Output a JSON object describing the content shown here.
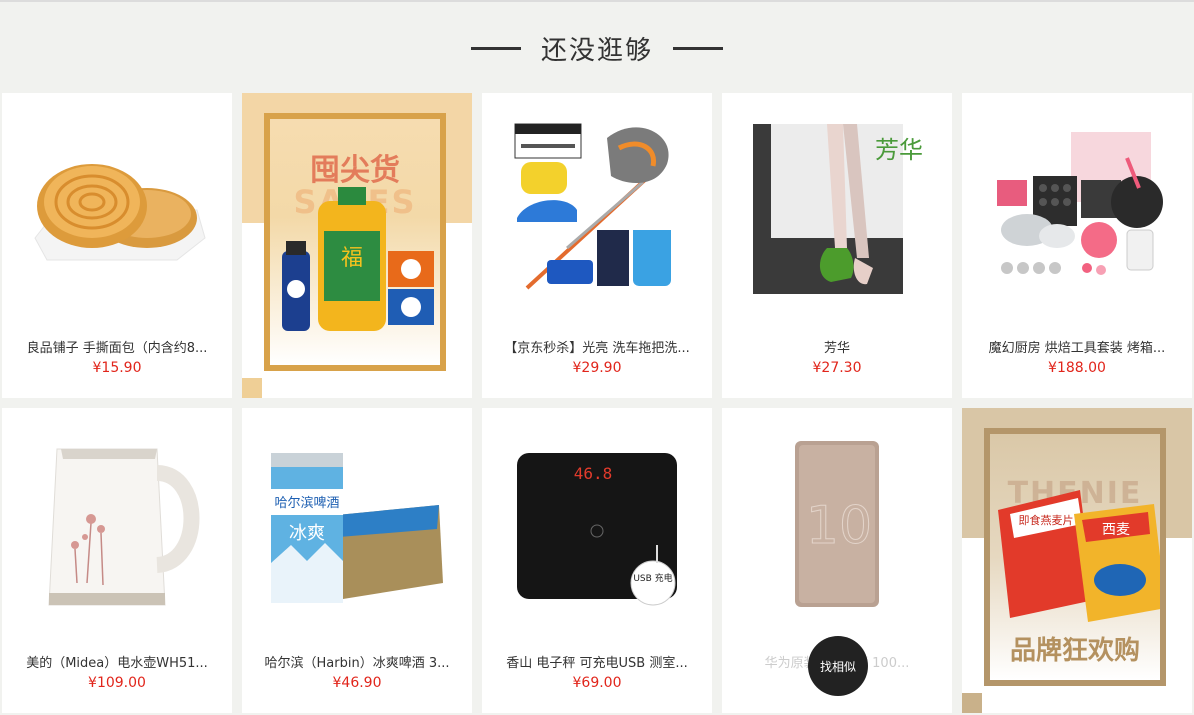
{
  "section": {
    "title": "还没逛够"
  },
  "products_row1": [
    {
      "name": "良品铺子 手撕面包（内含约8...",
      "price": "¥15.90",
      "icon": "bread-icon"
    },
    {
      "ad": true,
      "headline": "囤尖货",
      "sub": "SALES",
      "icon": "grocery-ad-icon"
    },
    {
      "name": "【京东秒杀】光亮 洗车拖把洗...",
      "price": "¥29.90",
      "icon": "car-wash-kit-icon"
    },
    {
      "name": "芳华",
      "price": "¥27.30",
      "icon": "book-cover-icon"
    },
    {
      "name": "魔幻厨房 烘焙工具套装 烤箱...",
      "price": "¥188.00",
      "icon": "baking-tools-icon"
    }
  ],
  "products_row2": [
    {
      "name": "美的（Midea）电水壶WH51...",
      "price": "¥109.00",
      "icon": "kettle-icon"
    },
    {
      "name": "哈尔滨（Harbin）冰爽啤酒 3...",
      "price": "¥46.90",
      "icon": "beer-icon"
    },
    {
      "name": "香山 电子秤 可充电USB 测室...",
      "price": "¥69.00",
      "icon": "scale-icon"
    },
    {
      "name": "华为原装快...超薄 100...",
      "price": "",
      "icon": "power-bank-icon",
      "hover_button": "找相似"
    },
    {
      "ad": true,
      "headline": "品牌狂欢购",
      "sub": "THENIE",
      "icon": "oatmeal-ad-icon"
    }
  ],
  "images": {
    "scale_display": "46.8",
    "usb_badge": "USB 充电",
    "beer_label": "哈尔滨啤酒",
    "beer_sub": "冰爽",
    "book_title": "芳华",
    "oat_brand_1": "即食燕麦片",
    "oat_brand_2": "西麦",
    "grocery_brand": "福"
  },
  "colors": {
    "price": "#e1251b",
    "accent_gold": "#c9a46a"
  }
}
